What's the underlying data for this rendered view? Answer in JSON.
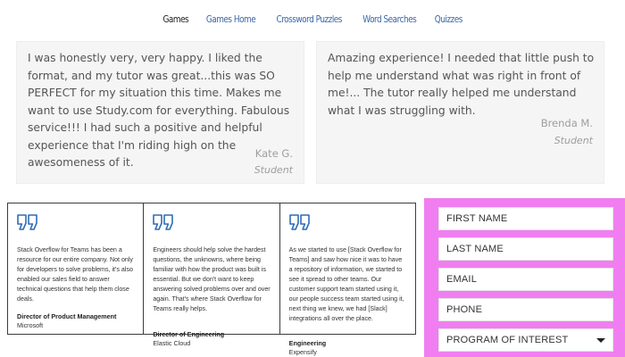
{
  "nav": {
    "items": [
      {
        "label": "Games",
        "active": true
      },
      {
        "label": "Games Home",
        "active": false
      },
      {
        "label": "Crossword Puzzles",
        "active": false
      },
      {
        "label": "Word Searches",
        "active": false
      },
      {
        "label": "Quizzes",
        "active": false
      }
    ]
  },
  "testimonials": [
    {
      "quote": "I was honestly very, very happy. I liked the format, and my tutor was great...this was SO PERFECT for my situation this time. Makes me want to use Study.com for everything. Fabulous service!!! I had such a positive and helpful experience that I'm riding high on the awesomeness of it.",
      "name": "Kate G.",
      "role": "Student"
    },
    {
      "quote": "Amazing experience! I needed that little push to help me understand what was right in front of me!... The tutor really helped me understand what I was struggling with.",
      "name": "Brenda M.",
      "role": "Student"
    }
  ],
  "so_testimonials": [
    {
      "icon": "quote-icon",
      "text": "Stack Overflow for Teams has been a resource for our entire company. Not only for developers to solve problems, it's also enabled our sales field to answer technical questions that help them close deals.",
      "title": "Director of Product Management",
      "org": "Microsoft"
    },
    {
      "icon": "quote-icon",
      "text": "Engineers should help solve the hardest questions, the unknowns, where being familiar with how the product was built is essential. But we don't want to keep answering solved problems over and over again. That's where Stack Overflow for Teams really helps.",
      "title": "Director of Engineering",
      "org": "Elastic Cloud"
    },
    {
      "icon": "quote-icon",
      "text": "As we started to use [Stack Overflow for Teams] and saw how nice it was to have a repository of information, we started to see it spread to other teams. Our customer support team started using it, our people success team started using it, next thing we knew, we had [Slack] integrations all over the place.",
      "title": "Engineering",
      "org": "Expensify"
    }
  ],
  "form": {
    "bg_color": "#f07ef0",
    "first_name_placeholder": "FIRST NAME",
    "last_name_placeholder": "LAST NAME",
    "email_placeholder": "EMAIL",
    "phone_placeholder": "PHONE",
    "program_label": "PROGRAM OF INTEREST",
    "program_icon": "chevron-down-icon"
  },
  "colors": {
    "nav_link": "#3a67a8",
    "quote_icon": "#2f6db5"
  }
}
